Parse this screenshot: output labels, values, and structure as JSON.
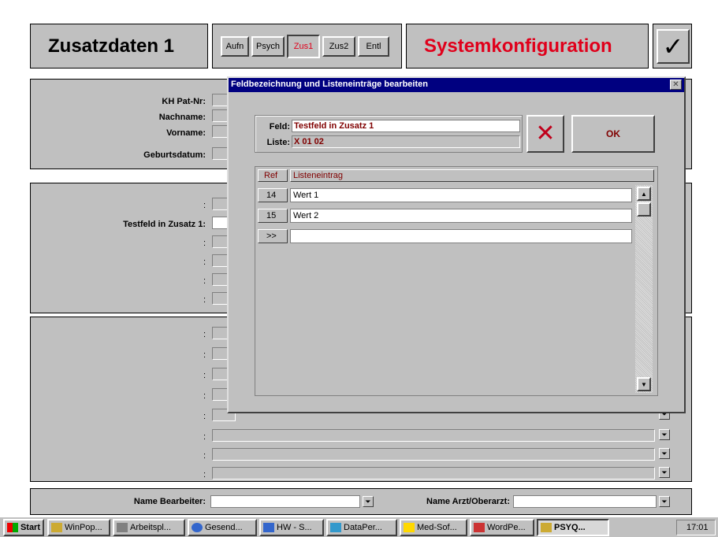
{
  "header": {
    "title": "Zusatzdaten 1",
    "tabs": [
      "Aufn",
      "Psych",
      "Zus1",
      "Zus2",
      "Entl"
    ],
    "system_label": "Systemkonfiguration",
    "check_symbol": "✓"
  },
  "patient": {
    "kh_label": "KH Pat-Nr:",
    "nachname_label": "Nachname:",
    "vorname_label": "Vorname:",
    "geburtsdatum_label": "Geburtsdatum:"
  },
  "zusatz": {
    "testfeld_label": "Testfeld in Zusatz 1:",
    "colon": ":"
  },
  "footer": {
    "bearbeiter_label": "Name Bearbeiter:",
    "arzt_label": "Name Arzt/Oberarzt:"
  },
  "dialog": {
    "title": "Feldbezeichnung und Listeneinträge bearbeiten",
    "feld_label": "Feld:",
    "feld_value": "Testfeld in Zusatz 1",
    "liste_label": "Liste:",
    "liste_value": "X 01 02",
    "ok_label": "OK",
    "col_ref": "Ref",
    "col_entry": "Listeneintrag",
    "rows": [
      {
        "ref": "14",
        "value": "Wert 1"
      },
      {
        "ref": "15",
        "value": "Wert 2"
      },
      {
        "ref": ">>",
        "value": ""
      }
    ]
  },
  "taskbar": {
    "start": "Start",
    "items": [
      "WinPop...",
      "Arbeitspl...",
      "Gesend...",
      "HW - S...",
      "DataPer...",
      "Med-Sof...",
      "WordPe...",
      "PSYQ..."
    ],
    "clock": "17:01"
  },
  "colors": {
    "accent_red": "#e0001b",
    "title_blue": "#000080",
    "dark_red": "#800000"
  }
}
